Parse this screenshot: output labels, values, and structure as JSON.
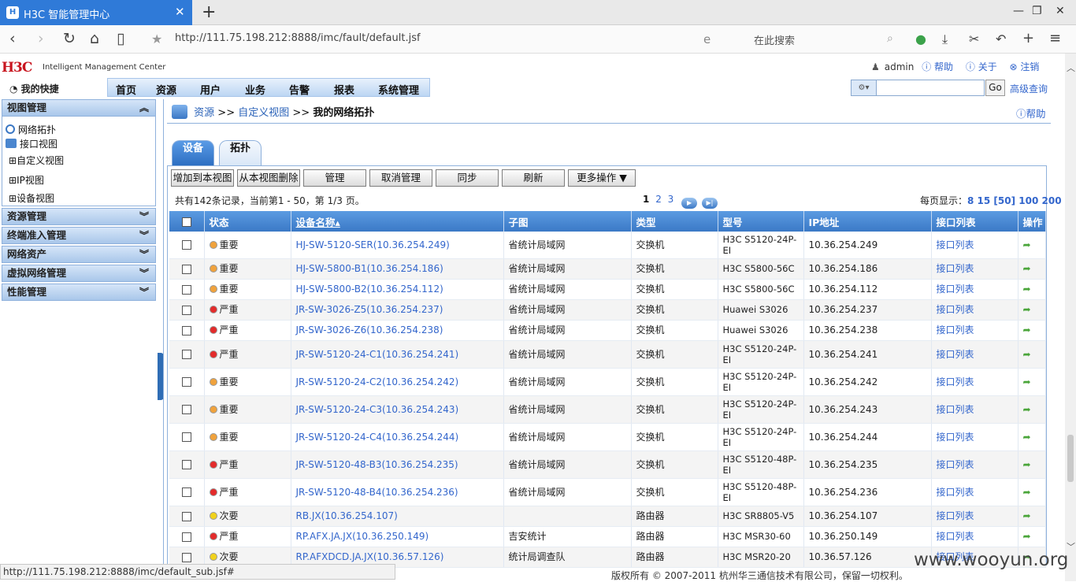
{
  "browser": {
    "tab_title": "H3C 智能管理中心",
    "url": "http://111.75.198.212:8888/imc/fault/default.jsf",
    "search_placeholder": "在此搜索"
  },
  "header": {
    "logo": "H3C",
    "logo_sub": "Intelligent Management Center",
    "user": "admin",
    "help": "帮助",
    "about": "关于",
    "logout": "注销",
    "quick": "我的快捷",
    "menu": [
      "首页",
      "资源",
      "用户",
      "业务",
      "告警",
      "报表",
      "系统管理"
    ],
    "go": "Go",
    "advanced": "高级查询"
  },
  "left": {
    "view_mgmt": "视图管理",
    "views": [
      "网络拓扑",
      "接口视图",
      "自定义视图",
      "IP视图",
      "设备视图"
    ],
    "sections": [
      "资源管理",
      "终端准入管理",
      "网络资产",
      "虚拟网络管理",
      "性能管理"
    ]
  },
  "breadcrumb": {
    "resource": "资源",
    "sep": ">>",
    "custom": "自定义视图",
    "current": "我的网络拓扑",
    "help": "帮助"
  },
  "tabs": [
    "设备",
    "拓扑"
  ],
  "toolbar": [
    "增加到本视图",
    "从本视图删除",
    "管理",
    "取消管理",
    "同步",
    "刷新",
    "更多操作"
  ],
  "paging": {
    "info": "共有142条记录，当前第1 - 50，第 1/3 页。",
    "pages": [
      "1",
      "2",
      "3"
    ],
    "per_page_label": "每页显示：",
    "per_page": "8 15 [50] 100 200"
  },
  "columns": [
    "状态",
    "设备名称▴",
    "子图",
    "类型",
    "型号",
    "IP地址",
    "接口列表",
    "操作"
  ],
  "colors": {
    "important": "#f0a23c",
    "severe": "#e32b2b",
    "minor": "#f1d21c"
  },
  "rows": [
    {
      "status": "重要",
      "level": "important",
      "name": "HJ-SW-5120-SER(10.36.254.249)",
      "sub": "省统计局域网",
      "type": "交换机",
      "model": "H3C S5120-24P-EI",
      "ip": "10.36.254.249",
      "iface": "接口列表"
    },
    {
      "status": "重要",
      "level": "important",
      "name": "HJ-SW-5800-B1(10.36.254.186)",
      "sub": "省统计局域网",
      "type": "交换机",
      "model": "H3C S5800-56C",
      "ip": "10.36.254.186",
      "iface": "接口列表"
    },
    {
      "status": "重要",
      "level": "important",
      "name": "HJ-SW-5800-B2(10.36.254.112)",
      "sub": "省统计局域网",
      "type": "交换机",
      "model": "H3C S5800-56C",
      "ip": "10.36.254.112",
      "iface": "接口列表"
    },
    {
      "status": "严重",
      "level": "severe",
      "name": "JR-SW-3026-Z5(10.36.254.237)",
      "sub": "省统计局域网",
      "type": "交换机",
      "model": "Huawei S3026",
      "ip": "10.36.254.237",
      "iface": "接口列表"
    },
    {
      "status": "严重",
      "level": "severe",
      "name": "JR-SW-3026-Z6(10.36.254.238)",
      "sub": "省统计局域网",
      "type": "交换机",
      "model": "Huawei S3026",
      "ip": "10.36.254.238",
      "iface": "接口列表"
    },
    {
      "status": "严重",
      "level": "severe",
      "name": "JR-SW-5120-24-C1(10.36.254.241)",
      "sub": "省统计局域网",
      "type": "交换机",
      "model": "H3C S5120-24P-EI",
      "ip": "10.36.254.241",
      "iface": "接口列表"
    },
    {
      "status": "重要",
      "level": "important",
      "name": "JR-SW-5120-24-C2(10.36.254.242)",
      "sub": "省统计局域网",
      "type": "交换机",
      "model": "H3C S5120-24P-EI",
      "ip": "10.36.254.242",
      "iface": "接口列表"
    },
    {
      "status": "重要",
      "level": "important",
      "name": "JR-SW-5120-24-C3(10.36.254.243)",
      "sub": "省统计局域网",
      "type": "交换机",
      "model": "H3C S5120-24P-EI",
      "ip": "10.36.254.243",
      "iface": "接口列表"
    },
    {
      "status": "重要",
      "level": "important",
      "name": "JR-SW-5120-24-C4(10.36.254.244)",
      "sub": "省统计局域网",
      "type": "交换机",
      "model": "H3C S5120-24P-EI",
      "ip": "10.36.254.244",
      "iface": "接口列表"
    },
    {
      "status": "严重",
      "level": "severe",
      "name": "JR-SW-5120-48-B3(10.36.254.235)",
      "sub": "省统计局域网",
      "type": "交换机",
      "model": "H3C S5120-48P-EI",
      "ip": "10.36.254.235",
      "iface": "接口列表"
    },
    {
      "status": "严重",
      "level": "severe",
      "name": "JR-SW-5120-48-B4(10.36.254.236)",
      "sub": "省统计局域网",
      "type": "交换机",
      "model": "H3C S5120-48P-EI",
      "ip": "10.36.254.236",
      "iface": "接口列表"
    },
    {
      "status": "次要",
      "level": "minor",
      "name": "RB.JX(10.36.254.107)",
      "sub": "",
      "type": "路由器",
      "model": "H3C SR8805-V5",
      "ip": "10.36.254.107",
      "iface": "接口列表"
    },
    {
      "status": "严重",
      "level": "severe",
      "name": "RP.AFX.JA.JX(10.36.250.149)",
      "sub": "吉安统计",
      "type": "路由器",
      "model": "H3C MSR30-60",
      "ip": "10.36.250.149",
      "iface": "接口列表"
    },
    {
      "status": "次要",
      "level": "minor",
      "name": "RP.AFXDCD.JA.JX(10.36.57.126)",
      "sub": "统计局调查队",
      "type": "路由器",
      "model": "H3C MSR20-20",
      "ip": "10.36.57.126",
      "iface": "接口列表"
    }
  ],
  "statusbar": "http://111.75.198.212:8888/imc/default_sub.jsf#",
  "copyright": "版权所有 © 2007-2011 杭州华三通信技术有限公司，保留一切权利。",
  "watermark": "www.wooyun.org"
}
